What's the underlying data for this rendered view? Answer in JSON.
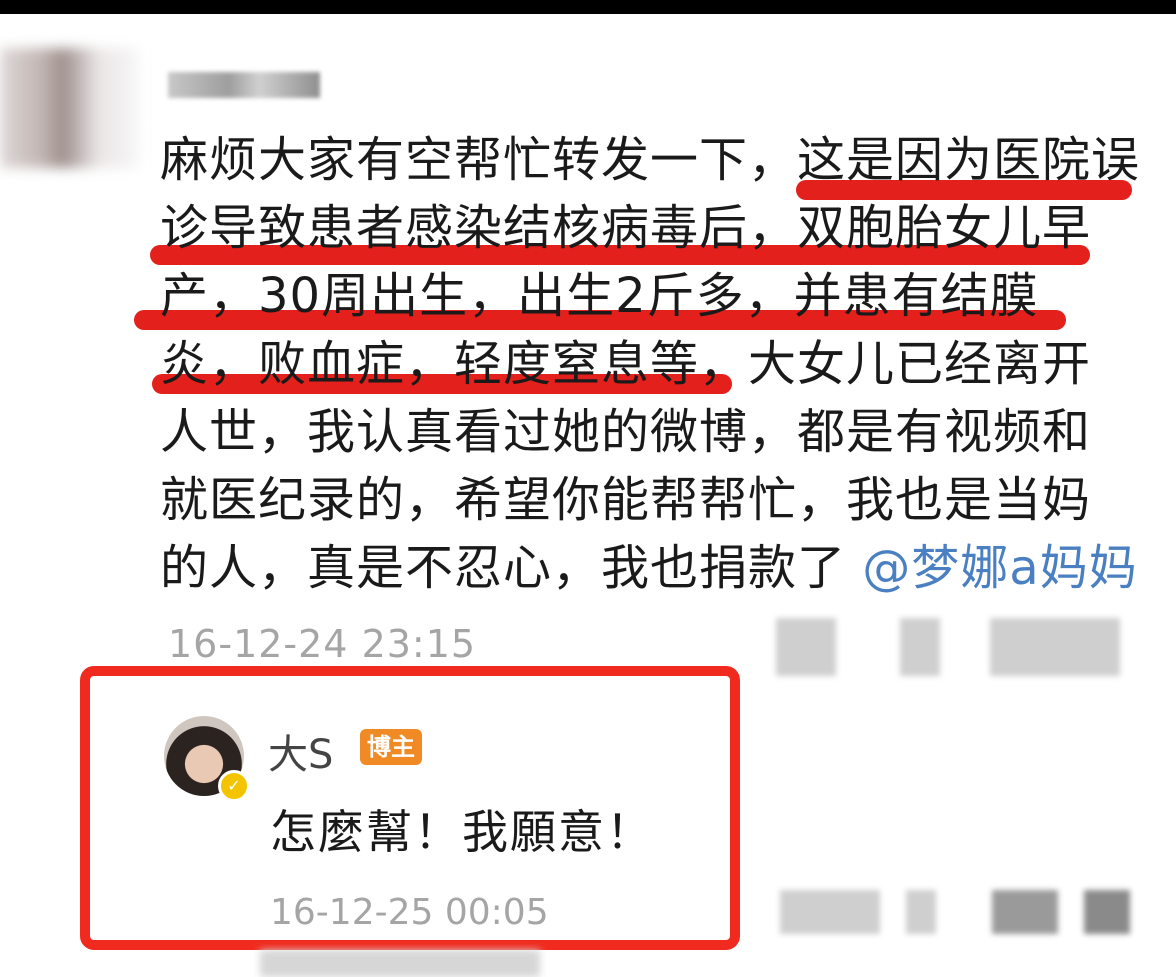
{
  "post": {
    "lines": [
      "麻烦大家有空帮忙转发一下，这是因为医院误",
      "诊导致患者感染结核病毒后，双胞胎女儿早",
      "产，30周出生，出生2斤多，并患有结膜",
      "炎，败血症，轻度窒息等，大女儿已经离开",
      "人世，我认真看过她的微博，都是有视频和",
      "就医纪录的，希望你能帮帮忙，我也是当妈"
    ],
    "last_line": "的人，真是不忍心，我也捐款了",
    "mention": "@梦娜a妈妈",
    "timestamp": "16-12-24 23:15"
  },
  "reply": {
    "name": "大S",
    "tag": "博主",
    "text": "怎麼幫！我願意！",
    "timestamp": "16-12-25 00:05"
  },
  "colors": {
    "highlight": "#e3201b",
    "box": "#f02a1e",
    "mention": "#4a7fc1",
    "tag": "#f08a24"
  }
}
